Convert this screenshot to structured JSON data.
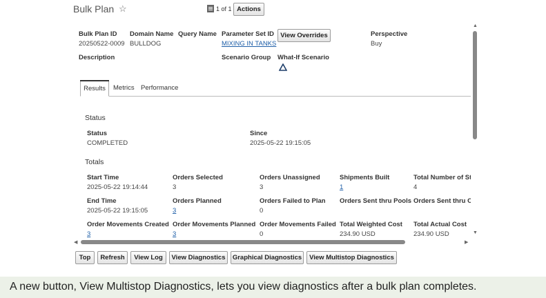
{
  "header": {
    "title": "Bulk Plan",
    "page_indicator": "1 of 1",
    "actions_label": "Actions"
  },
  "details": {
    "bulk_plan_id_label": "Bulk Plan ID",
    "bulk_plan_id": "20250522-0009",
    "domain_name_label": "Domain Name",
    "domain_name": "BULLDOG",
    "query_name_label": "Query Name",
    "parameter_set_id_label": "Parameter Set ID",
    "parameter_set_id": "MIXING IN TANKS",
    "view_overrides_label": "View Overrides",
    "perspective_label": "Perspective",
    "perspective": "Buy",
    "description_label": "Description",
    "scenario_group_label": "Scenario Group",
    "what_if_scenario_label": "What-If Scenario"
  },
  "tabs": [
    "Results",
    "Metrics",
    "Performance"
  ],
  "status": {
    "section": "Status",
    "status_label": "Status",
    "status_value": "COMPLETED",
    "since_label": "Since",
    "since_value": "2025-05-22 19:15:05"
  },
  "totals": {
    "section": "Totals",
    "start_time_label": "Start Time",
    "start_time": "2025-05-22 19:14:44",
    "orders_selected_label": "Orders Selected",
    "orders_selected": "3",
    "orders_unassigned_label": "Orders Unassigned",
    "orders_unassigned": "3",
    "shipments_built_label": "Shipments Built",
    "shipments_built": "1",
    "total_number_label": "Total Number of St",
    "total_number": "4",
    "end_time_label": "End Time",
    "end_time": "2025-05-22 19:15:05",
    "orders_planned_label": "Orders Planned",
    "orders_planned": "3",
    "orders_failed_label": "Orders Failed to Plan",
    "orders_failed": "0",
    "orders_sent_pools_label": "Orders Sent thru Pools",
    "orders_sent_c_label": "Orders Sent thru C",
    "order_movements_created_label": "Order Movements Created",
    "order_movements_created": "3",
    "order_movements_planned_label": "Order Movements Planned",
    "order_movements_planned": "3",
    "order_movements_failed_label": "Order Movements Failed",
    "order_movements_failed": "0",
    "total_weighted_cost_label": "Total Weighted Cost",
    "total_weighted_cost": "234.90 USD",
    "total_actual_cost_label": "Total Actual Cost",
    "total_actual_cost": "234.90 USD"
  },
  "footer_buttons": {
    "top": "Top",
    "refresh": "Refresh",
    "view_log": "View Log",
    "view_diagnostics": "View Diagnostics",
    "graphical_diagnostics": "Graphical Diagnostics",
    "view_multistop_diagnostics": "View Multistop Diagnostics"
  },
  "caption": "A new button, View Multistop Diagnostics, lets you view diagnostics after a bulk plan completes.",
  "icons": {
    "star": "star-icon",
    "page": "page-icon",
    "what_if": "triangle-icon"
  },
  "colors": {
    "link": "#1f5fa8",
    "caption_bg": "#ecf1e8"
  }
}
